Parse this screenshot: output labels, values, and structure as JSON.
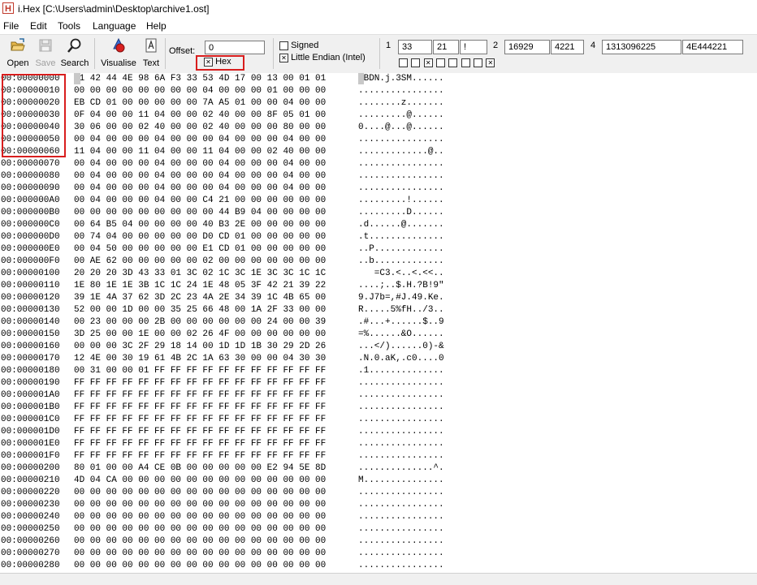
{
  "window": {
    "app_icon": "H",
    "title": "i.Hex [C:\\Users\\admin\\Desktop\\archive1.ost]"
  },
  "menu": [
    "File",
    "Edit",
    "Tools",
    "Language",
    "Help"
  ],
  "toolbar": {
    "open_label": "Open",
    "save_label": "Save",
    "search_label": "Search",
    "visualise_label": "Visualise",
    "text_label": "Text",
    "offset_label": "Offset:",
    "offset_value": "0",
    "hex_label": "Hex",
    "hex_checked": true,
    "signed_label": "Signed",
    "signed_checked": false,
    "little_endian_label": "Little Endian (Intel)",
    "little_endian_checked": true
  },
  "values": {
    "label1": "1",
    "v1a": "33",
    "v1b": "21",
    "v1c": "!",
    "label2": "2",
    "v2a": "16929",
    "v2b": "4221",
    "label4": "4",
    "v4a": "1313096225",
    "v4b": "4E444221",
    "bits": [
      false,
      false,
      true,
      false,
      false,
      false,
      false,
      true
    ]
  },
  "rows": [
    {
      "addr": "00:00000000",
      "bytes": "21 42 44 4E 98 6A F3 33 53 4D 17 00 13 00 01 01",
      "ascii": "!BDN.j.3SM......"
    },
    {
      "addr": "00:00000010",
      "bytes": "00 00 00 00 00 00 00 00 04 00 00 00 01 00 00 00",
      "ascii": "................"
    },
    {
      "addr": "00:00000020",
      "bytes": "EB CD 01 00 00 00 00 00 7A A5 01 00 00 04 00 00",
      "ascii": "........z......."
    },
    {
      "addr": "00:00000030",
      "bytes": "0F 04 00 00 11 04 00 00 02 40 00 00 8F 05 01 00",
      "ascii": ".........@......"
    },
    {
      "addr": "00:00000040",
      "bytes": "30 06 00 00 02 40 00 00 02 40 00 00 00 80 00 00",
      "ascii": "0....@...@......"
    },
    {
      "addr": "00:00000050",
      "bytes": "00 04 00 00 00 04 00 00 00 04 00 00 00 04 00 00",
      "ascii": "................"
    },
    {
      "addr": "00:00000060",
      "bytes": "11 04 00 00 11 04 00 00 11 04 00 00 02 40 00 00",
      "ascii": ".............@.."
    },
    {
      "addr": "00:00000070",
      "bytes": "00 04 00 00 00 04 00 00 00 04 00 00 00 04 00 00",
      "ascii": "................"
    },
    {
      "addr": "00:00000080",
      "bytes": "00 04 00 00 00 04 00 00 00 04 00 00 00 04 00 00",
      "ascii": "................"
    },
    {
      "addr": "00:00000090",
      "bytes": "00 04 00 00 00 04 00 00 00 04 00 00 00 04 00 00",
      "ascii": "................"
    },
    {
      "addr": "00:000000A0",
      "bytes": "00 04 00 00 00 04 00 00 C4 21 00 00 00 00 00 00",
      "ascii": ".........!......"
    },
    {
      "addr": "00:000000B0",
      "bytes": "00 00 00 00 00 00 00 00 00 44 B9 04 00 00 00 00",
      "ascii": ".........D......"
    },
    {
      "addr": "00:000000C0",
      "bytes": "00 64 B5 04 00 00 00 00 40 B3 2E 00 00 00 00 00",
      "ascii": ".d......@......."
    },
    {
      "addr": "00:000000D0",
      "bytes": "00 74 04 00 00 00 00 00 D0 CD 01 00 00 00 00 00",
      "ascii": ".t.............."
    },
    {
      "addr": "00:000000E0",
      "bytes": "00 04 50 00 00 00 00 00 E1 CD 01 00 00 00 00 00",
      "ascii": "..P............."
    },
    {
      "addr": "00:000000F0",
      "bytes": "00 AE 62 00 00 00 00 00 02 00 00 00 00 00 00 00",
      "ascii": "..b............."
    },
    {
      "addr": "00:00000100",
      "bytes": "20 20 20 3D 43 33 01 3C 02 1C 3C 1E 3C 3C 1C 1C",
      "ascii": "   =C3.<..<.<<.."
    },
    {
      "addr": "00:00000110",
      "bytes": "1E 80 1E 1E 3B 1C 1C 24 1E 48 05 3F 42 21 39 22",
      "ascii": "....;..$.H.?B!9\""
    },
    {
      "addr": "00:00000120",
      "bytes": "39 1E 4A 37 62 3D 2C 23 4A 2E 34 39 1C 4B 65 00",
      "ascii": "9.J7b=,#J.49.Ke."
    },
    {
      "addr": "00:00000130",
      "bytes": "52 00 00 1D 00 00 35 25 66 48 00 1A 2F 33 00 00",
      "ascii": "R.....5%fH../3.."
    },
    {
      "addr": "00:00000140",
      "bytes": "00 23 00 00 00 2B 00 00 00 00 00 00 24 00 00 39",
      "ascii": ".#...+......$..9"
    },
    {
      "addr": "00:00000150",
      "bytes": "3D 25 00 00 1E 00 00 02 26 4F 00 00 00 00 00 00",
      "ascii": "=%......&O......"
    },
    {
      "addr": "00:00000160",
      "bytes": "00 00 00 3C 2F 29 18 14 00 1D 1D 1B 30 29 2D 26",
      "ascii": "...</)......0)-&"
    },
    {
      "addr": "00:00000170",
      "bytes": "12 4E 00 30 19 61 4B 2C 1A 63 30 00 00 04 30 30",
      "ascii": ".N.0.aK,.c0....0"
    },
    {
      "addr": "00:00000180",
      "bytes": "00 31 00 00 01 FF FF FF FF FF FF FF FF FF FF FF",
      "ascii": ".1.............."
    },
    {
      "addr": "00:00000190",
      "bytes": "FF FF FF FF FF FF FF FF FF FF FF FF FF FF FF FF",
      "ascii": "................"
    },
    {
      "addr": "00:000001A0",
      "bytes": "FF FF FF FF FF FF FF FF FF FF FF FF FF FF FF FF",
      "ascii": "................"
    },
    {
      "addr": "00:000001B0",
      "bytes": "FF FF FF FF FF FF FF FF FF FF FF FF FF FF FF FF",
      "ascii": "................"
    },
    {
      "addr": "00:000001C0",
      "bytes": "FF FF FF FF FF FF FF FF FF FF FF FF FF FF FF FF",
      "ascii": "................"
    },
    {
      "addr": "00:000001D0",
      "bytes": "FF FF FF FF FF FF FF FF FF FF FF FF FF FF FF FF",
      "ascii": "................"
    },
    {
      "addr": "00:000001E0",
      "bytes": "FF FF FF FF FF FF FF FF FF FF FF FF FF FF FF FF",
      "ascii": "................"
    },
    {
      "addr": "00:000001F0",
      "bytes": "FF FF FF FF FF FF FF FF FF FF FF FF FF FF FF FF",
      "ascii": "................"
    },
    {
      "addr": "00:00000200",
      "bytes": "80 01 00 00 A4 CE 0B 00 00 00 00 00 E2 94 5E 8D",
      "ascii": "..............^."
    },
    {
      "addr": "00:00000210",
      "bytes": "4D 04 CA 00 00 00 00 00 00 00 00 00 00 00 00 00",
      "ascii": "M..............."
    },
    {
      "addr": "00:00000220",
      "bytes": "00 00 00 00 00 00 00 00 00 00 00 00 00 00 00 00",
      "ascii": "................"
    },
    {
      "addr": "00:00000230",
      "bytes": "00 00 00 00 00 00 00 00 00 00 00 00 00 00 00 00",
      "ascii": "................"
    },
    {
      "addr": "00:00000240",
      "bytes": "00 00 00 00 00 00 00 00 00 00 00 00 00 00 00 00",
      "ascii": "................"
    },
    {
      "addr": "00:00000250",
      "bytes": "00 00 00 00 00 00 00 00 00 00 00 00 00 00 00 00",
      "ascii": "................"
    },
    {
      "addr": "00:00000260",
      "bytes": "00 00 00 00 00 00 00 00 00 00 00 00 00 00 00 00",
      "ascii": "................"
    },
    {
      "addr": "00:00000270",
      "bytes": "00 00 00 00 00 00 00 00 00 00 00 00 00 00 00 00",
      "ascii": "................"
    },
    {
      "addr": "00:00000280",
      "bytes": "00 00 00 00 00 00 00 00 00 00 00 00 00 00 00 00",
      "ascii": "................"
    }
  ]
}
